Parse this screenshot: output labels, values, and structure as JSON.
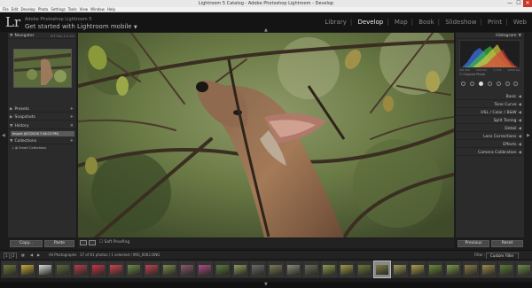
{
  "window": {
    "title": "Lightroom 5 Catalog - Adobe Photoshop Lightroom - Develop",
    "minimize": "—",
    "maximize": "☐",
    "close": "✕"
  },
  "menu": [
    "File",
    "Edit",
    "Develop",
    "Photo",
    "Settings",
    "Tools",
    "View",
    "Window",
    "Help"
  ],
  "identity": {
    "logo": "Lr",
    "catalog_line": "Adobe Photoshop Lightroom 5",
    "get_started": "Get started with Lightroom mobile"
  },
  "modules": [
    "Library",
    "Develop",
    "Map",
    "Book",
    "Slideshow",
    "Print",
    "Web"
  ],
  "active_module": "Develop",
  "left_panel": {
    "navigator": "Navigator",
    "navigator_options": "FIT  FILL  1:1  3:1",
    "presets": "Presets",
    "snapshots": "Snapshots",
    "history": "History",
    "history_item": "Import (6/7/2016 7:46:23 PM)",
    "collections": "Collections",
    "collection_item": "Smart Collections"
  },
  "right_panel": {
    "histogram": "Histogram",
    "hist_values": [
      "ISO 200",
      "100 mm",
      "f / 5.6",
      "1/250 sec"
    ],
    "original_photo": "Original Photo",
    "sections": [
      "Basic",
      "Tone Curve",
      "HSL / Color / B&W",
      "Split Toning",
      "Detail",
      "Lens Corrections",
      "Effects",
      "Camera Calibration"
    ]
  },
  "toolbar": {
    "copy": "Copy...",
    "paste": "Paste",
    "soft_proofing": "Soft Proofing",
    "previous": "Previous",
    "reset": "Reset"
  },
  "filmstrip_bar": {
    "pages": [
      "1",
      "2"
    ],
    "source": "All Photographs",
    "info": "37 of 61 photos / 1 selected / IMG_0062.DNG",
    "filter_label": "Filter :",
    "filter_value": "Custom Filter"
  },
  "filmstrip": {
    "selected_index": 21,
    "thumb_colors": [
      "#6b7a3a",
      "#c9a93a",
      "#d7d7d7",
      "#5a6a3a",
      "#b83a4a",
      "#c9304a",
      "#d04050",
      "#6a8a4a",
      "#c04050",
      "#7a8a4a",
      "#8a5a6a",
      "#b04a8a",
      "#5a7a3a",
      "#8a9a5a",
      "#6a6a6a",
      "#7a7a5a",
      "#8a8a7a",
      "#6a6a5a",
      "#8a9a4a",
      "#a09a4a",
      "#6a7a3a",
      "#7a7a4a",
      "#a09a5a",
      "#b0a04a",
      "#6a8a3a",
      "#7a9a4a",
      "#8a7a4a",
      "#9a8a4a",
      "#5a7a3a",
      "#6a8a4a"
    ]
  },
  "colors": {
    "accent": "#ededed",
    "background": "#1c1c1c",
    "panel": "#2b2b2b"
  }
}
